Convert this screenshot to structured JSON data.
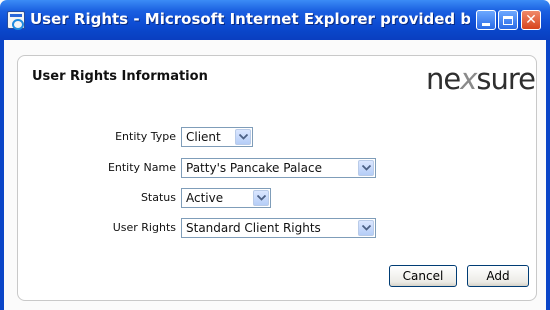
{
  "window": {
    "title": "User Rights - Microsoft Internet Explorer provided by ...",
    "minimize_icon": "minimize-icon",
    "maximize_icon": "maximize-icon",
    "close_icon": "close-icon",
    "close_glyph": "✕"
  },
  "panel": {
    "heading": "User Rights Information",
    "logo": {
      "part1": "ne",
      "part2": "x",
      "part3": "sure"
    }
  },
  "form": {
    "entity_type": {
      "label": "Entity Type",
      "value": "Client"
    },
    "entity_name": {
      "label": "Entity Name",
      "value": "Patty's Pancake Palace"
    },
    "status": {
      "label": "Status",
      "value": "Active"
    },
    "user_rights": {
      "label": "User Rights",
      "value": "Standard Client Rights"
    }
  },
  "buttons": {
    "cancel": "Cancel",
    "add": "Add"
  },
  "colors": {
    "titlebar": "#0f4fd6",
    "close_button": "#d8431c",
    "select_border": "#7f9db9"
  }
}
